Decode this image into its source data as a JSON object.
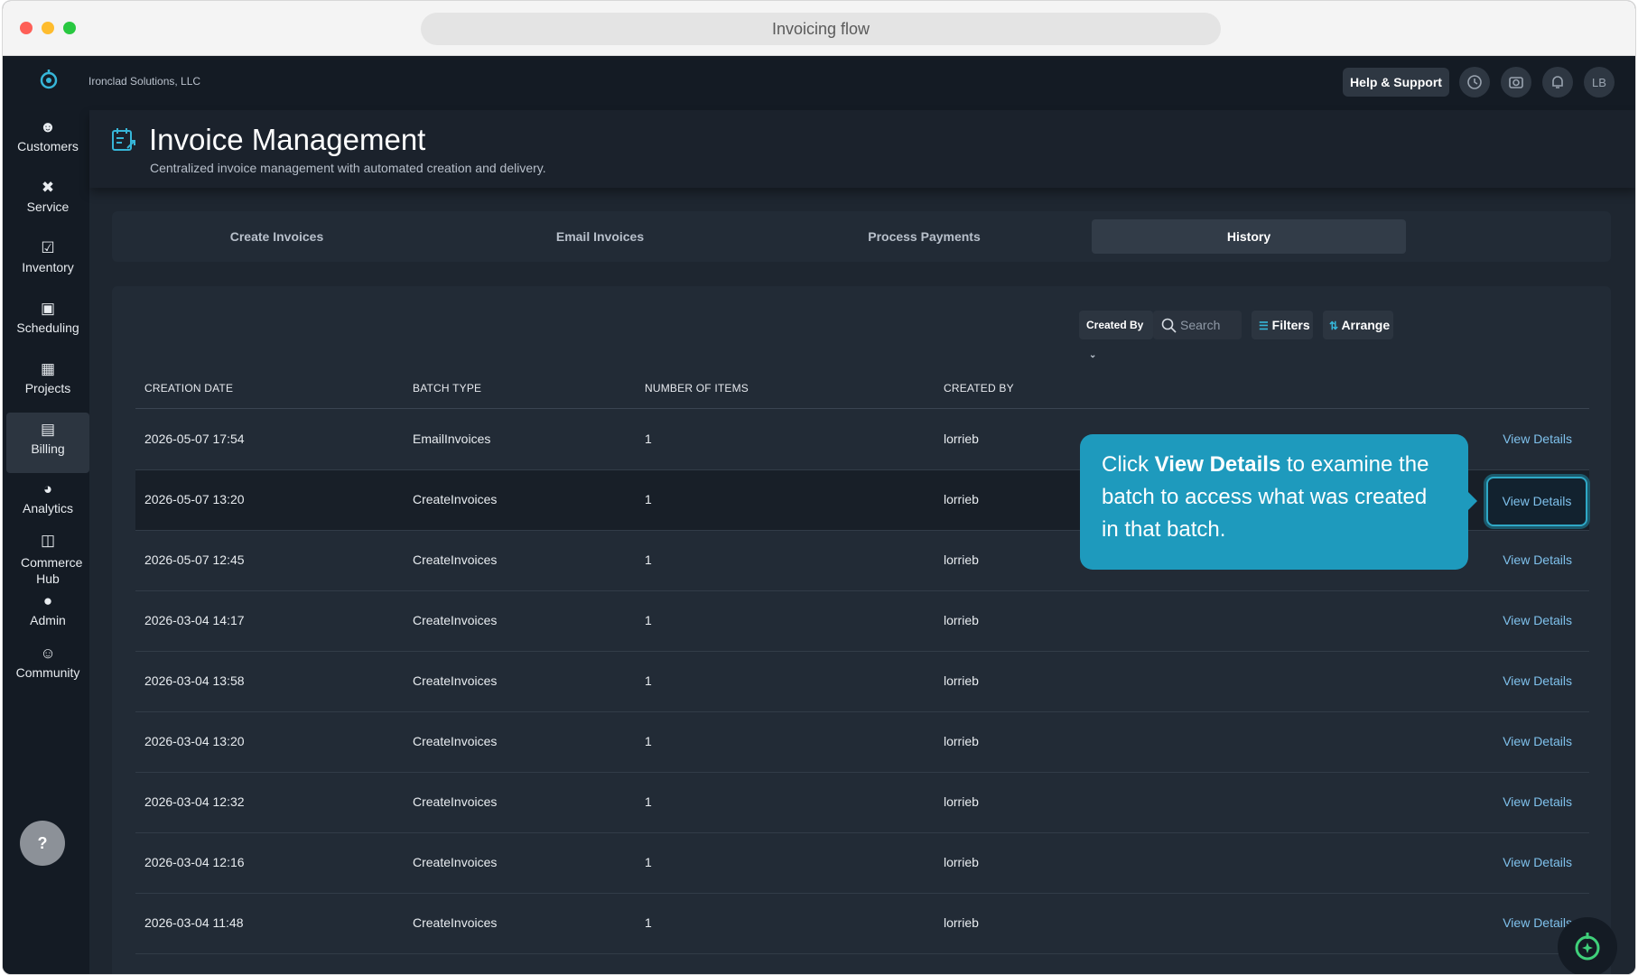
{
  "browser": {
    "title": "Invoicing flow"
  },
  "topbar": {
    "company": "Ironclad Solutions, LLC",
    "help_label": "Help & Support",
    "avatar_initials": "LB"
  },
  "sidebar": {
    "items": [
      {
        "label": "Customers",
        "icon": "customers-icon"
      },
      {
        "label": "Service",
        "icon": "service-icon"
      },
      {
        "label": "Inventory",
        "icon": "inventory-icon"
      },
      {
        "label": "Scheduling",
        "icon": "calendar-icon"
      },
      {
        "label": "Projects",
        "icon": "projects-icon"
      },
      {
        "label": "Billing",
        "icon": "bank-icon"
      },
      {
        "label": "Analytics",
        "icon": "pie-chart-icon"
      },
      {
        "label": "Commerce Hub",
        "icon": "store-icon"
      },
      {
        "label": "Admin",
        "icon": "admin-icon"
      },
      {
        "label": "Community",
        "icon": "community-icon"
      }
    ],
    "help_glyph": "?"
  },
  "header": {
    "title": "Invoice Management",
    "subtitle": "Centralized invoice management with automated creation and delivery."
  },
  "tabs": [
    {
      "label": "Create Invoices"
    },
    {
      "label": "Email Invoices"
    },
    {
      "label": "Process Payments"
    },
    {
      "label": "History"
    }
  ],
  "toolbar": {
    "created_by_label": "Created By",
    "search_placeholder": "Search",
    "filters_label": "Filters",
    "arrange_label": "Arrange"
  },
  "table": {
    "columns": [
      "CREATION DATE",
      "BATCH TYPE",
      "NUMBER OF ITEMS",
      "CREATED BY"
    ],
    "rows": [
      {
        "date": "2026-05-07 17:54",
        "type": "EmailInvoices",
        "items": "1",
        "by": "lorrieb",
        "action": "View Details"
      },
      {
        "date": "2026-05-07 13:20",
        "type": "CreateInvoices",
        "items": "1",
        "by": "lorrieb",
        "action": "View Details"
      },
      {
        "date": "2026-05-07 12:45",
        "type": "CreateInvoices",
        "items": "1",
        "by": "lorrieb",
        "action": "View Details"
      },
      {
        "date": "2026-03-04 14:17",
        "type": "CreateInvoices",
        "items": "1",
        "by": "lorrieb",
        "action": "View Details"
      },
      {
        "date": "2026-03-04 13:58",
        "type": "CreateInvoices",
        "items": "1",
        "by": "lorrieb",
        "action": "View Details"
      },
      {
        "date": "2026-03-04 13:20",
        "type": "CreateInvoices",
        "items": "1",
        "by": "lorrieb",
        "action": "View Details"
      },
      {
        "date": "2026-03-04 12:32",
        "type": "CreateInvoices",
        "items": "1",
        "by": "lorrieb",
        "action": "View Details"
      },
      {
        "date": "2026-03-04 12:16",
        "type": "CreateInvoices",
        "items": "1",
        "by": "lorrieb",
        "action": "View Details"
      },
      {
        "date": "2026-03-04 11:48",
        "type": "CreateInvoices",
        "items": "1",
        "by": "lorrieb",
        "action": "View Details"
      }
    ]
  },
  "tooltip": {
    "prefix": "Click ",
    "bold": "View Details",
    "suffix": " to examine the batch to access what was created in that batch."
  },
  "colors": {
    "accent": "#1e9abd",
    "link": "#7fc1ec",
    "background": "#1e2630",
    "sidebar": "#141b24"
  }
}
